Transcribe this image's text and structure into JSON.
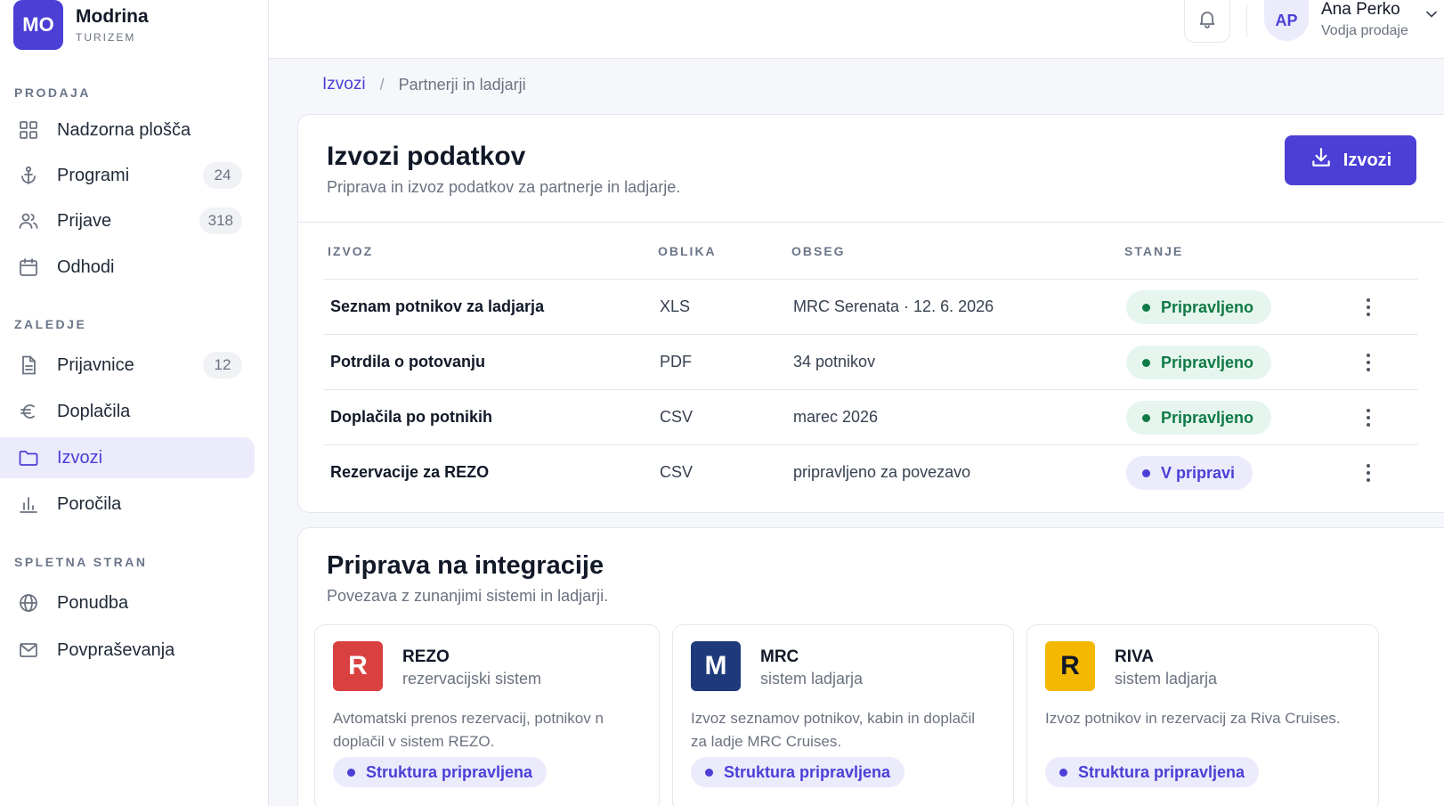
{
  "brand": {
    "logo": "MO",
    "name": "Modrina",
    "subtitle": "TURIZEM",
    "color": "#4b3fd6"
  },
  "sidebar": {
    "sections": [
      {
        "title": "PRODAJA",
        "items": [
          {
            "label": "Nadzorna plošča",
            "icon": "grid-icon",
            "count": null
          },
          {
            "label": "Programi",
            "icon": "anchor-icon",
            "count": "24"
          },
          {
            "label": "Prijave",
            "icon": "users-icon",
            "count": "318"
          },
          {
            "label": "Odhodi",
            "icon": "calendar-icon",
            "count": null
          }
        ]
      },
      {
        "title": "ZALEDJE",
        "items": [
          {
            "label": "Prijavnice",
            "icon": "document-icon",
            "count": "12"
          },
          {
            "label": "Doplačila",
            "icon": "euro-icon",
            "count": null
          },
          {
            "label": "Izvozi",
            "icon": "folder-icon",
            "count": null,
            "active": true
          },
          {
            "label": "Poročila",
            "icon": "bar-chart-icon",
            "count": null
          }
        ]
      },
      {
        "title": "SPLETNA STRAN",
        "items": [
          {
            "label": "Ponudba",
            "icon": "globe-icon",
            "count": null
          },
          {
            "label": "Povpraševanja",
            "icon": "mail-icon",
            "count": null
          }
        ]
      }
    ]
  },
  "topbar": {
    "notification_icon": "bell-icon",
    "user": {
      "initials": "AP",
      "name": "Ana Perko",
      "role": "Vodja prodaje"
    }
  },
  "breadcrumb": {
    "parent": "Izvozi",
    "separator": "/",
    "current": "Partnerji in ladjarji"
  },
  "exports": {
    "title": "Izvozi podatkov",
    "subtitle": "Priprava in izvoz podatkov za partnerje in ladjarje.",
    "button_label": "Izvozi",
    "columns": [
      "IZVOZ",
      "OBLIKA",
      "OBSEG",
      "STANJE"
    ],
    "rows": [
      {
        "name": "Seznam potnikov za ladjarja",
        "format": "XLS",
        "scope": "MRC Serenata · 12. 6. 2026",
        "status": "Pripravljeno",
        "status_kind": "ok"
      },
      {
        "name": "Potrdila o potovanju",
        "format": "PDF",
        "scope": "34 potnikov",
        "status": "Pripravljeno",
        "status_kind": "ok"
      },
      {
        "name": "Doplačila po potnikih",
        "format": "CSV",
        "scope": "marec 2026",
        "status": "Pripravljeno",
        "status_kind": "ok"
      },
      {
        "name": "Rezervacije za REZO",
        "format": "CSV",
        "scope": "pripravljeno za povezavo",
        "status": "V pripravi",
        "status_kind": "wip"
      }
    ]
  },
  "integrations": {
    "title": "Priprava na integracije",
    "subtitle": "Povezava z zunanjimi sistemi in ladjarji.",
    "cards": [
      {
        "logo": "R",
        "logo_color": "#d94141",
        "logo_text_color": "#ffffff",
        "name": "REZO",
        "type": "rezervacijski sistem",
        "description": "Avtomatski prenos rezervacij, potnikov n doplačil v sistem REZO.",
        "badge": "Struktura pripravljena"
      },
      {
        "logo": "M",
        "logo_color": "#1e3a7b",
        "logo_text_color": "#ffffff",
        "name": "MRC",
        "type": "sistem ladjarja",
        "description": "Izvoz seznamov potnikov, kabin in doplačil za ladje MRC Cruises.",
        "badge": "Struktura pripravljena"
      },
      {
        "logo": "R",
        "logo_color": "#f5b800",
        "logo_text_color": "#111827",
        "name": "RIVA",
        "type": "sistem ladjarja",
        "description": "Izvoz potnikov in rezervacij za Riva Cruises.",
        "badge": "Struktura pripravljena"
      }
    ]
  }
}
